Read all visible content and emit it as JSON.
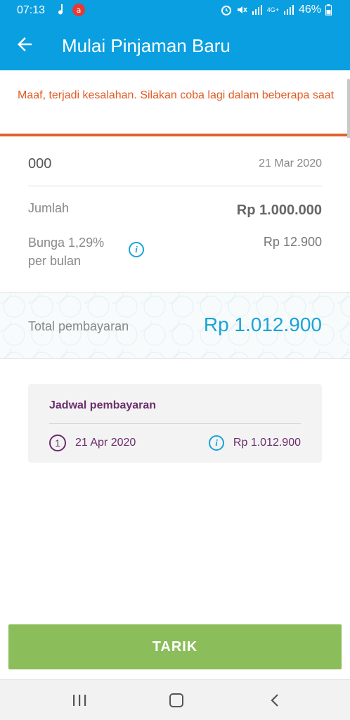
{
  "status_bar": {
    "time": "07:13",
    "battery": "46%",
    "network": "4G+"
  },
  "app_bar": {
    "title": "Mulai Pinjaman Baru",
    "back_icon": "arrow-left-icon"
  },
  "error_banner": {
    "message": "Maaf, terjadi kesalahan. Silakan coba lagi dalam beberapa saat",
    "color": "#e05a22"
  },
  "loan": {
    "id": "000",
    "date": "21 Mar 2020",
    "amount_label": "Jumlah",
    "amount_value": "Rp 1.000.000",
    "interest_label": "Bunga 1,29% per bulan",
    "interest_value": "Rp 12.900"
  },
  "total": {
    "label": "Total pembayaran",
    "value": "Rp 1.012.900"
  },
  "schedule": {
    "title": "Jadwal pembayaran",
    "items": [
      {
        "number": "1",
        "date": "21 Apr 2020",
        "amount": "Rp 1.012.900"
      }
    ]
  },
  "actions": {
    "tarik_label": "TARIK"
  },
  "colors": {
    "primary": "#0a9fe0",
    "accent_purple": "#6b2d6b",
    "button_green": "#8bbd5a",
    "total_blue": "#1aa3d8"
  }
}
